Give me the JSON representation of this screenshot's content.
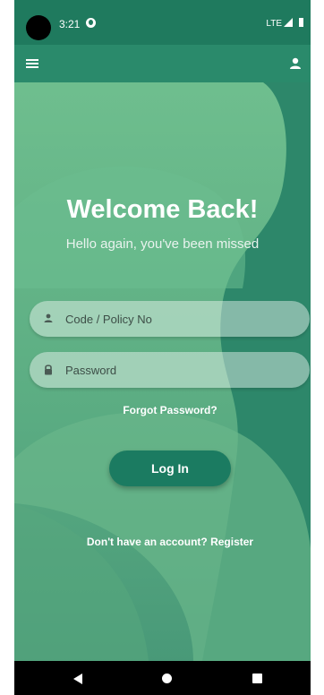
{
  "status_bar": {
    "time": "3:21",
    "network": "LTE"
  },
  "app_bar": {
    "left_icon": "menu-icon",
    "right_icon": "user-icon"
  },
  "login": {
    "title": "Welcome Back!",
    "subtitle": "Hello again, you've been missed",
    "code_field": {
      "placeholder": "Code / Policy No",
      "value": "",
      "icon": "user-icon"
    },
    "password_field": {
      "placeholder": "Password",
      "value": "",
      "icon": "lock-icon"
    },
    "forgot_password": "Forgot Password?",
    "login_button": "Log In",
    "register_prompt": "Don't have an account? Register"
  },
  "nav_bar": {
    "icons": [
      "back-icon",
      "home-icon",
      "recents-icon"
    ]
  },
  "colors": {
    "status_bar": "#1f7a5e",
    "app_bar": "#2a8a6b",
    "background": "#2f8a6c",
    "light_shape": "#6cbb8c",
    "button": "#1b7b61"
  }
}
